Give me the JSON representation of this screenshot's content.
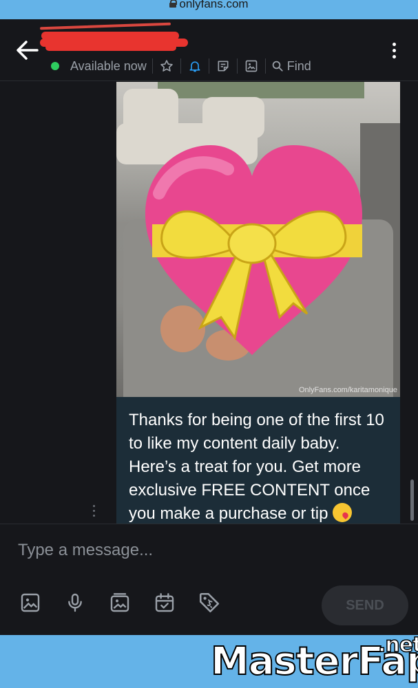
{
  "browser": {
    "url": "onlyfans.com"
  },
  "header": {
    "status": "Available now",
    "find_label": "Find",
    "icons": [
      "back-arrow-icon",
      "star-icon",
      "bell-icon",
      "sticky-note-icon",
      "image-icon",
      "search-icon",
      "more-vertical-icon"
    ],
    "status_color": "#2ecc5f",
    "accent": "#2a9df4"
  },
  "conversation": {
    "photo_watermark": "OnlyFans.com/karitamonique",
    "message": "Thanks for being one of the first 10 to like my content daily baby. Here’s a treat for you. Get more exclusive FREE CONTENT once you make a purchase or tip",
    "message_emoji": "kissing-face-emoji",
    "bubble_color": "#1c2d38"
  },
  "composer": {
    "placeholder": "Type a message...",
    "send_label": "SEND",
    "tools": [
      "image-icon",
      "microphone-icon",
      "media-vault-icon",
      "calendar-check-icon",
      "price-tag-icon"
    ]
  },
  "footer": {
    "brand_text": "MasterFap",
    "brand_tld": ".net",
    "background": "#64b3e8"
  }
}
